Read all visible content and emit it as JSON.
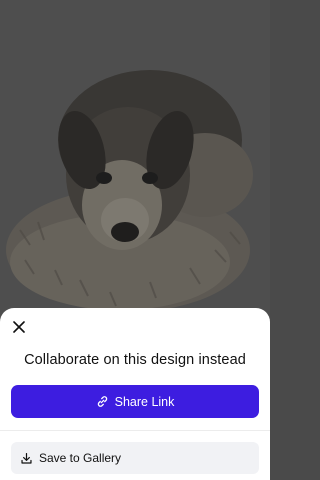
{
  "sheet": {
    "title": "Collaborate on this design instead",
    "share_label": "Share Link",
    "gallery_label": "Save to Gallery"
  },
  "icons": {
    "close": "close-icon",
    "link": "link-icon",
    "download": "download-icon"
  },
  "colors": {
    "primary": "#3d1de0",
    "sheet_bg": "#ffffff",
    "secondary_btn_bg": "#f1f2f5"
  }
}
